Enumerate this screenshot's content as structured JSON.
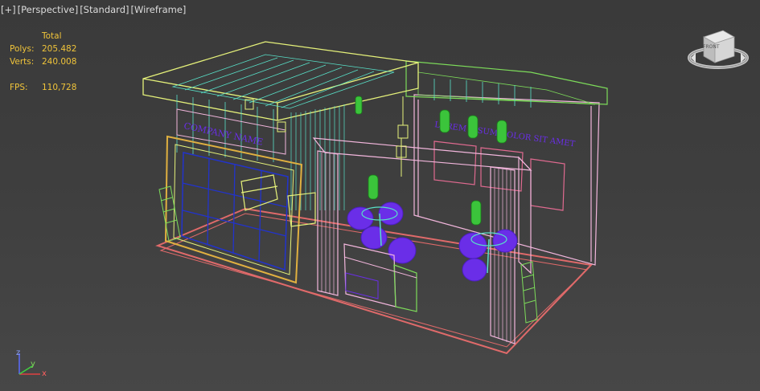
{
  "viewport": {
    "menus": [
      "[+]",
      "[Perspective]",
      "[Standard]",
      "[Wireframe]"
    ]
  },
  "stats": {
    "header": "Total",
    "polys_label": "Polys:",
    "polys_value": "205.482",
    "verts_label": "Verts:",
    "verts_value": "240.008",
    "fps_label": "FPS:",
    "fps_value": "110,728"
  },
  "viewcube": {
    "face_label": "FRONT"
  },
  "axis": {
    "x": "x",
    "y": "y",
    "z": "z"
  },
  "scene": {
    "sign_left": "COMPANY NAME",
    "sign_right": "LOREM IPSUM DOLOR SIT AMET"
  },
  "colors": {
    "background_top": "#3a3a3a",
    "background_bottom": "#474747",
    "stats_text": "#f0c43a",
    "wire_yellow": "#e6f27a",
    "wire_cyan": "#58e0c8",
    "wire_pink": "#f2b6dc",
    "wire_green": "#7ddc5a",
    "wire_blue": "#2233cc",
    "wire_purple": "#6a2ee8",
    "wire_red": "#e06a6a",
    "wire_gold": "#e0b040"
  }
}
